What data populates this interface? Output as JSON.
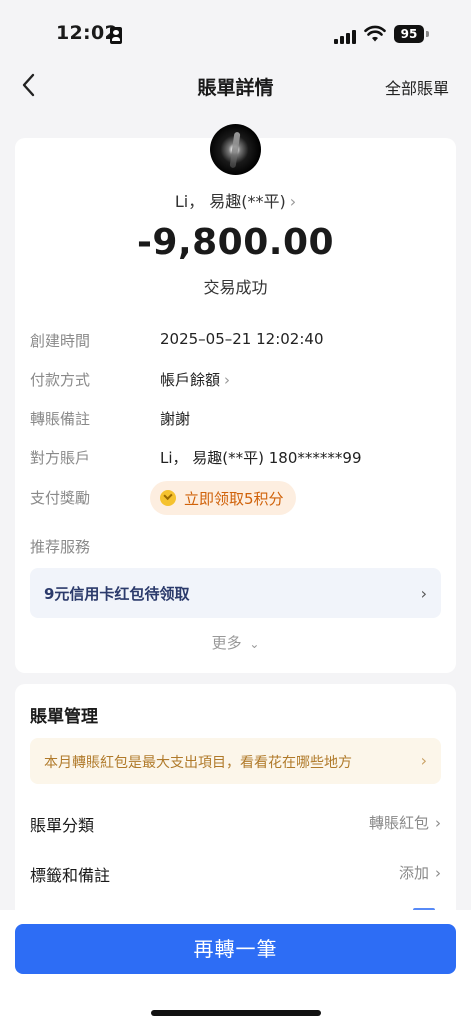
{
  "status_bar": {
    "time": "12:02",
    "battery": "95"
  },
  "nav": {
    "title": "賬單詳情",
    "right_link": "全部賬單"
  },
  "summary": {
    "payee": "Li， 易趣(**平)",
    "amount": "-9,800.00",
    "status": "交易成功"
  },
  "details": [
    {
      "label": "創建時間",
      "value": "2025–05–21 12:02:40"
    },
    {
      "label": "付款方式",
      "value": "帳戶餘額"
    },
    {
      "label": "轉賬備註",
      "value": "謝謝"
    },
    {
      "label": "對方賬戶",
      "value": "Li， 易趣(**平) 180******99"
    },
    {
      "label": "支付獎勵",
      "value": "立即领取5积分"
    },
    {
      "label": "推荐服務",
      "value": ""
    }
  ],
  "promo": {
    "text": "9元信用卡红包待领取"
  },
  "more": {
    "label": "更多"
  },
  "manage": {
    "title": "賬單管理",
    "tip": "本月轉賬紅包是最大支出項目，看看花在哪些地方",
    "rows": [
      {
        "label": "賬單分類",
        "value": "轉賬紅包"
      },
      {
        "label": "標籤和備註",
        "value": "添加"
      }
    ]
  },
  "bottom": {
    "button": "再轉一筆"
  },
  "colors": {
    "primary": "#2d6df5",
    "reward": "#d0620a",
    "tip": "#b07a2a"
  }
}
